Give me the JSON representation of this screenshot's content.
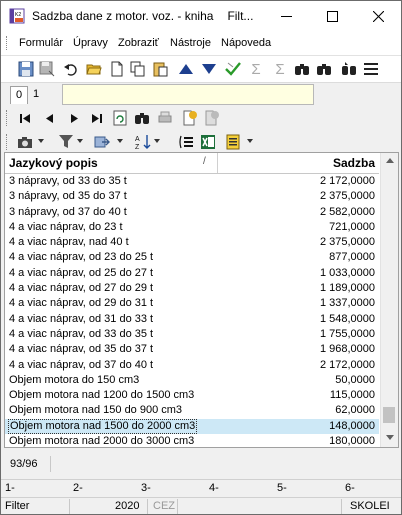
{
  "window": {
    "title": "Sadzba dane z motor. voz. - kniha",
    "title_suffix": "Filt..."
  },
  "menu": [
    "Formulár",
    "Úpravy",
    "Zobraziť",
    "Nástroje",
    "Nápoveda"
  ],
  "toolbar_icons": [
    "save-icon",
    "save-as-icon",
    "undo-icon",
    "open-folder-icon",
    "new-icon",
    "copy-icon",
    "paste-icon",
    "arrow-up-icon",
    "arrow-down-icon",
    "check-icon",
    "sum-icon",
    "sum-off-icon",
    "find-icon",
    "find-next-icon",
    "find-replace-icon",
    "menu-lines-icon"
  ],
  "tabs": [
    "0",
    "1"
  ],
  "grid": {
    "columns": {
      "desc": "Jazykový popis",
      "rate": "Sadzba",
      "sort_indicator": "/"
    },
    "rows": [
      {
        "desc": "3 nápravy, od 33 do 35 t",
        "rate": "2 172,0000"
      },
      {
        "desc": "3 nápravy, od 35 do 37 t",
        "rate": "2 375,0000"
      },
      {
        "desc": "3 nápravy, od 37 do 40 t",
        "rate": "2 582,0000"
      },
      {
        "desc": "4 a viac náprav, do 23 t",
        "rate": "721,0000"
      },
      {
        "desc": "4 a viac náprav, nad 40 t",
        "rate": "2 375,0000"
      },
      {
        "desc": "4 a viac náprav, od 23 do 25 t",
        "rate": "877,0000"
      },
      {
        "desc": "4 a viac náprav, od 25 do 27 t",
        "rate": "1 033,0000"
      },
      {
        "desc": "4 a viac náprav, od 27 do 29 t",
        "rate": "1 189,0000"
      },
      {
        "desc": "4 a viac náprav, od 29 do 31 t",
        "rate": "1 337,0000"
      },
      {
        "desc": "4 a viac náprav, od 31 do 33 t",
        "rate": "1 548,0000"
      },
      {
        "desc": "4 a viac náprav, od 33 do 35 t",
        "rate": "1 755,0000"
      },
      {
        "desc": "4 a viac náprav, od 35 do 37 t",
        "rate": "1 968,0000"
      },
      {
        "desc": "4 a viac náprav, od 37 do 40 t",
        "rate": "2 172,0000"
      },
      {
        "desc": "Objem motora do 150 cm3",
        "rate": "50,0000"
      },
      {
        "desc": "Objem motora nad 1200 do 1500 cm3",
        "rate": "115,0000"
      },
      {
        "desc": "Objem motora nad 150 do 900 cm3",
        "rate": "62,0000"
      },
      {
        "desc": "Objem motora nad 1500 do 2000 cm3",
        "rate": "148,0000",
        "selected": true
      },
      {
        "desc": "Objem motora nad 2000 do 3000 cm3",
        "rate": "180,0000"
      }
    ]
  },
  "record_counter": "93/96",
  "column_markers": [
    "1-",
    "2-",
    "3-",
    "4-",
    "5-",
    "6-"
  ],
  "status": {
    "mode": "Filter",
    "year": "2020",
    "currency": "CEZ",
    "user": "SKOLEI"
  }
}
